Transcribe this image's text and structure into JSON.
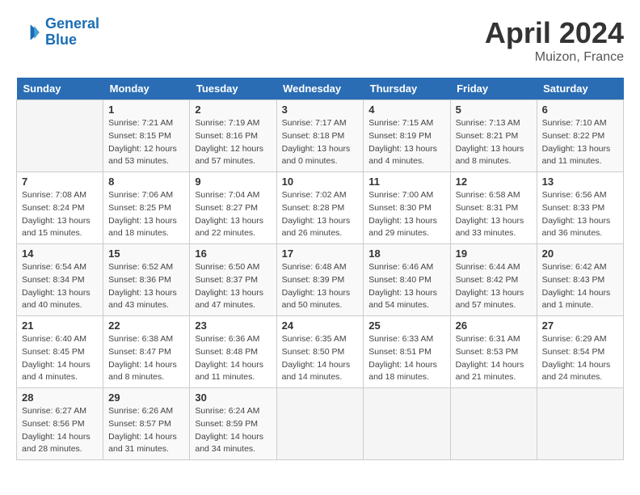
{
  "header": {
    "logo_line1": "General",
    "logo_line2": "Blue",
    "month": "April 2024",
    "location": "Muizon, France"
  },
  "days_of_week": [
    "Sunday",
    "Monday",
    "Tuesday",
    "Wednesday",
    "Thursday",
    "Friday",
    "Saturday"
  ],
  "weeks": [
    [
      {
        "num": "",
        "info": ""
      },
      {
        "num": "1",
        "info": "Sunrise: 7:21 AM\nSunset: 8:15 PM\nDaylight: 12 hours\nand 53 minutes."
      },
      {
        "num": "2",
        "info": "Sunrise: 7:19 AM\nSunset: 8:16 PM\nDaylight: 12 hours\nand 57 minutes."
      },
      {
        "num": "3",
        "info": "Sunrise: 7:17 AM\nSunset: 8:18 PM\nDaylight: 13 hours\nand 0 minutes."
      },
      {
        "num": "4",
        "info": "Sunrise: 7:15 AM\nSunset: 8:19 PM\nDaylight: 13 hours\nand 4 minutes."
      },
      {
        "num": "5",
        "info": "Sunrise: 7:13 AM\nSunset: 8:21 PM\nDaylight: 13 hours\nand 8 minutes."
      },
      {
        "num": "6",
        "info": "Sunrise: 7:10 AM\nSunset: 8:22 PM\nDaylight: 13 hours\nand 11 minutes."
      }
    ],
    [
      {
        "num": "7",
        "info": "Sunrise: 7:08 AM\nSunset: 8:24 PM\nDaylight: 13 hours\nand 15 minutes."
      },
      {
        "num": "8",
        "info": "Sunrise: 7:06 AM\nSunset: 8:25 PM\nDaylight: 13 hours\nand 18 minutes."
      },
      {
        "num": "9",
        "info": "Sunrise: 7:04 AM\nSunset: 8:27 PM\nDaylight: 13 hours\nand 22 minutes."
      },
      {
        "num": "10",
        "info": "Sunrise: 7:02 AM\nSunset: 8:28 PM\nDaylight: 13 hours\nand 26 minutes."
      },
      {
        "num": "11",
        "info": "Sunrise: 7:00 AM\nSunset: 8:30 PM\nDaylight: 13 hours\nand 29 minutes."
      },
      {
        "num": "12",
        "info": "Sunrise: 6:58 AM\nSunset: 8:31 PM\nDaylight: 13 hours\nand 33 minutes."
      },
      {
        "num": "13",
        "info": "Sunrise: 6:56 AM\nSunset: 8:33 PM\nDaylight: 13 hours\nand 36 minutes."
      }
    ],
    [
      {
        "num": "14",
        "info": "Sunrise: 6:54 AM\nSunset: 8:34 PM\nDaylight: 13 hours\nand 40 minutes."
      },
      {
        "num": "15",
        "info": "Sunrise: 6:52 AM\nSunset: 8:36 PM\nDaylight: 13 hours\nand 43 minutes."
      },
      {
        "num": "16",
        "info": "Sunrise: 6:50 AM\nSunset: 8:37 PM\nDaylight: 13 hours\nand 47 minutes."
      },
      {
        "num": "17",
        "info": "Sunrise: 6:48 AM\nSunset: 8:39 PM\nDaylight: 13 hours\nand 50 minutes."
      },
      {
        "num": "18",
        "info": "Sunrise: 6:46 AM\nSunset: 8:40 PM\nDaylight: 13 hours\nand 54 minutes."
      },
      {
        "num": "19",
        "info": "Sunrise: 6:44 AM\nSunset: 8:42 PM\nDaylight: 13 hours\nand 57 minutes."
      },
      {
        "num": "20",
        "info": "Sunrise: 6:42 AM\nSunset: 8:43 PM\nDaylight: 14 hours\nand 1 minute."
      }
    ],
    [
      {
        "num": "21",
        "info": "Sunrise: 6:40 AM\nSunset: 8:45 PM\nDaylight: 14 hours\nand 4 minutes."
      },
      {
        "num": "22",
        "info": "Sunrise: 6:38 AM\nSunset: 8:47 PM\nDaylight: 14 hours\nand 8 minutes."
      },
      {
        "num": "23",
        "info": "Sunrise: 6:36 AM\nSunset: 8:48 PM\nDaylight: 14 hours\nand 11 minutes."
      },
      {
        "num": "24",
        "info": "Sunrise: 6:35 AM\nSunset: 8:50 PM\nDaylight: 14 hours\nand 14 minutes."
      },
      {
        "num": "25",
        "info": "Sunrise: 6:33 AM\nSunset: 8:51 PM\nDaylight: 14 hours\nand 18 minutes."
      },
      {
        "num": "26",
        "info": "Sunrise: 6:31 AM\nSunset: 8:53 PM\nDaylight: 14 hours\nand 21 minutes."
      },
      {
        "num": "27",
        "info": "Sunrise: 6:29 AM\nSunset: 8:54 PM\nDaylight: 14 hours\nand 24 minutes."
      }
    ],
    [
      {
        "num": "28",
        "info": "Sunrise: 6:27 AM\nSunset: 8:56 PM\nDaylight: 14 hours\nand 28 minutes."
      },
      {
        "num": "29",
        "info": "Sunrise: 6:26 AM\nSunset: 8:57 PM\nDaylight: 14 hours\nand 31 minutes."
      },
      {
        "num": "30",
        "info": "Sunrise: 6:24 AM\nSunset: 8:59 PM\nDaylight: 14 hours\nand 34 minutes."
      },
      {
        "num": "",
        "info": ""
      },
      {
        "num": "",
        "info": ""
      },
      {
        "num": "",
        "info": ""
      },
      {
        "num": "",
        "info": ""
      }
    ]
  ]
}
